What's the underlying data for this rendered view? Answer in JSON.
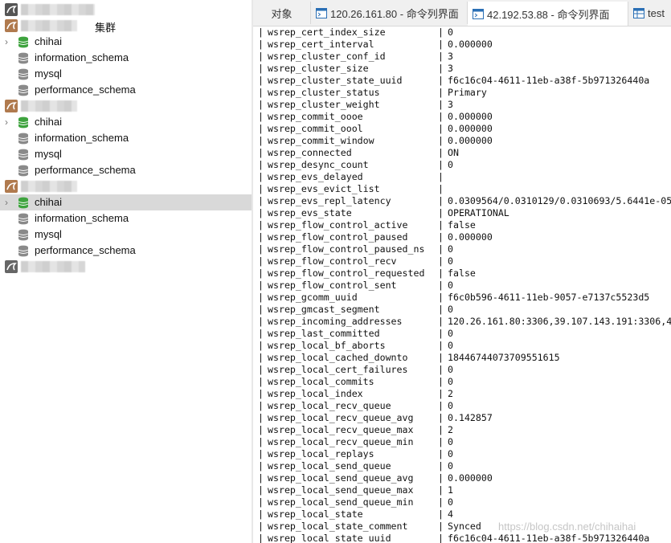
{
  "sidebar": {
    "connections": [
      {
        "suffix": "",
        "databases": []
      },
      {
        "suffix": "集群",
        "databases": [
          "chihai",
          "information_schema",
          "mysql",
          "performance_schema"
        ]
      },
      {
        "suffix": "",
        "databases": [
          "chihai",
          "information_schema",
          "mysql",
          "performance_schema"
        ]
      },
      {
        "suffix": "",
        "databases": [
          "chihai",
          "information_schema",
          "mysql",
          "performance_schema"
        ],
        "selected_index": 0
      },
      {
        "suffix": "",
        "databases": []
      }
    ]
  },
  "tabs": [
    {
      "label": "对象",
      "icon": "none"
    },
    {
      "label": "120.26.161.80 - 命令列界面",
      "icon": "terminal-icon"
    },
    {
      "label": "42.192.53.88 - 命令列界面",
      "icon": "terminal-icon",
      "active": true
    },
    {
      "label": "test",
      "icon": "table-icon"
    }
  ],
  "console": {
    "rows": [
      {
        "name": "wsrep_cert_index_size",
        "value": "0"
      },
      {
        "name": "wsrep_cert_interval",
        "value": "0.000000"
      },
      {
        "name": "wsrep_cluster_conf_id",
        "value": "3"
      },
      {
        "name": "wsrep_cluster_size",
        "value": "3"
      },
      {
        "name": "wsrep_cluster_state_uuid",
        "value": "f6c16c04-4611-11eb-a38f-5b971326440a"
      },
      {
        "name": "wsrep_cluster_status",
        "value": "Primary"
      },
      {
        "name": "wsrep_cluster_weight",
        "value": "3"
      },
      {
        "name": "wsrep_commit_oooe",
        "value": "0.000000"
      },
      {
        "name": "wsrep_commit_oool",
        "value": "0.000000"
      },
      {
        "name": "wsrep_commit_window",
        "value": "0.000000"
      },
      {
        "name": "wsrep_connected",
        "value": "ON"
      },
      {
        "name": "wsrep_desync_count",
        "value": "0"
      },
      {
        "name": "wsrep_evs_delayed",
        "value": ""
      },
      {
        "name": "wsrep_evs_evict_list",
        "value": ""
      },
      {
        "name": "wsrep_evs_repl_latency",
        "value": "0.0309564/0.0310129/0.0310693/5.6441e-05"
      },
      {
        "name": "wsrep_evs_state",
        "value": "OPERATIONAL"
      },
      {
        "name": "wsrep_flow_control_active",
        "value": "false"
      },
      {
        "name": "wsrep_flow_control_paused",
        "value": "0.000000"
      },
      {
        "name": "wsrep_flow_control_paused_ns",
        "value": "0"
      },
      {
        "name": "wsrep_flow_control_recv",
        "value": "0"
      },
      {
        "name": "wsrep_flow_control_requested",
        "value": "false"
      },
      {
        "name": "wsrep_flow_control_sent",
        "value": "0"
      },
      {
        "name": "wsrep_gcomm_uuid",
        "value": "f6c0b596-4611-11eb-9057-e7137c5523d5"
      },
      {
        "name": "wsrep_gmcast_segment",
        "value": "0"
      },
      {
        "name": "wsrep_incoming_addresses",
        "value": "120.26.161.80:3306,39.107.143.191:3306,4"
      },
      {
        "name": "wsrep_last_committed",
        "value": "0"
      },
      {
        "name": "wsrep_local_bf_aborts",
        "value": "0"
      },
      {
        "name": "wsrep_local_cached_downto",
        "value": "18446744073709551615"
      },
      {
        "name": "wsrep_local_cert_failures",
        "value": "0"
      },
      {
        "name": "wsrep_local_commits",
        "value": "0"
      },
      {
        "name": "wsrep_local_index",
        "value": "2"
      },
      {
        "name": "wsrep_local_recv_queue",
        "value": "0"
      },
      {
        "name": "wsrep_local_recv_queue_avg",
        "value": "0.142857"
      },
      {
        "name": "wsrep_local_recv_queue_max",
        "value": "2"
      },
      {
        "name": "wsrep_local_recv_queue_min",
        "value": "0"
      },
      {
        "name": "wsrep_local_replays",
        "value": "0"
      },
      {
        "name": "wsrep_local_send_queue",
        "value": "0"
      },
      {
        "name": "wsrep_local_send_queue_avg",
        "value": "0.000000"
      },
      {
        "name": "wsrep_local_send_queue_max",
        "value": "1"
      },
      {
        "name": "wsrep_local_send_queue_min",
        "value": "0"
      },
      {
        "name": "wsrep_local_state",
        "value": "4"
      },
      {
        "name": "wsrep_local_state_comment",
        "value": "Synced"
      },
      {
        "name": "wsrep_local_state_uuid",
        "value": "f6c16c04-4611-11eb-a38f-5b971326440a"
      }
    ]
  },
  "watermark": "https://blog.csdn.net/chihaihai",
  "colors": {
    "db_green": "#3ea33e",
    "db_gray": "#8a8a8a",
    "conn_brown": "#b07a4e",
    "selected_row": "#d9d9d9"
  }
}
